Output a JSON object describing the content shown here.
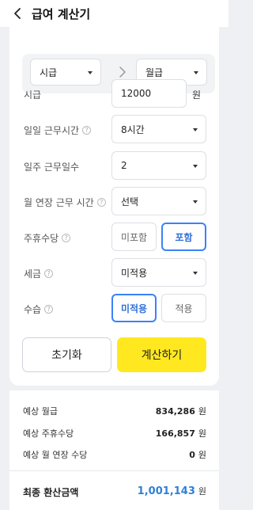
{
  "header": {
    "title": "급여 계산기",
    "back_icon": "chevron-left-icon"
  },
  "converter": {
    "from_label": "시급",
    "to_label": "월급",
    "arrow_icon": "chevron-right-icon"
  },
  "fields": {
    "hourly_wage": {
      "label": "시급",
      "value": "12000",
      "unit": "원"
    },
    "daily_hours": {
      "label": "일일 근무시간",
      "value": "8시간"
    },
    "weekly_days": {
      "label": "일주 근무일수",
      "value": "2"
    },
    "monthly_overtime": {
      "label": "월 연장 근무 시간",
      "value": "선택"
    },
    "weekly_holiday_pay": {
      "label": "주휴수당",
      "options": [
        "미포함",
        "포함"
      ],
      "selected": "포함"
    },
    "tax": {
      "label": "세금",
      "value": "미적용"
    },
    "probation": {
      "label": "수습",
      "options": [
        "미적용",
        "적용"
      ],
      "selected": "미적용"
    }
  },
  "help_icon": "?",
  "actions": {
    "reset_label": "초기화",
    "calculate_label": "계산하기"
  },
  "results": {
    "monthly_pay": {
      "label": "예상 월급",
      "value": "834,286",
      "unit": "원"
    },
    "holiday_pay": {
      "label": "예상 주휴수당",
      "value": "166,857",
      "unit": "원"
    },
    "overtime_pay": {
      "label": "예상 월 연장 수당",
      "value": "0",
      "unit": "원"
    },
    "total": {
      "label": "최종 환산금액",
      "value": "1,001,143",
      "unit": "원"
    }
  },
  "colors": {
    "accent": "#3b82f6",
    "calc_button": "#ffe81f",
    "total_value": "#2f80d6"
  }
}
